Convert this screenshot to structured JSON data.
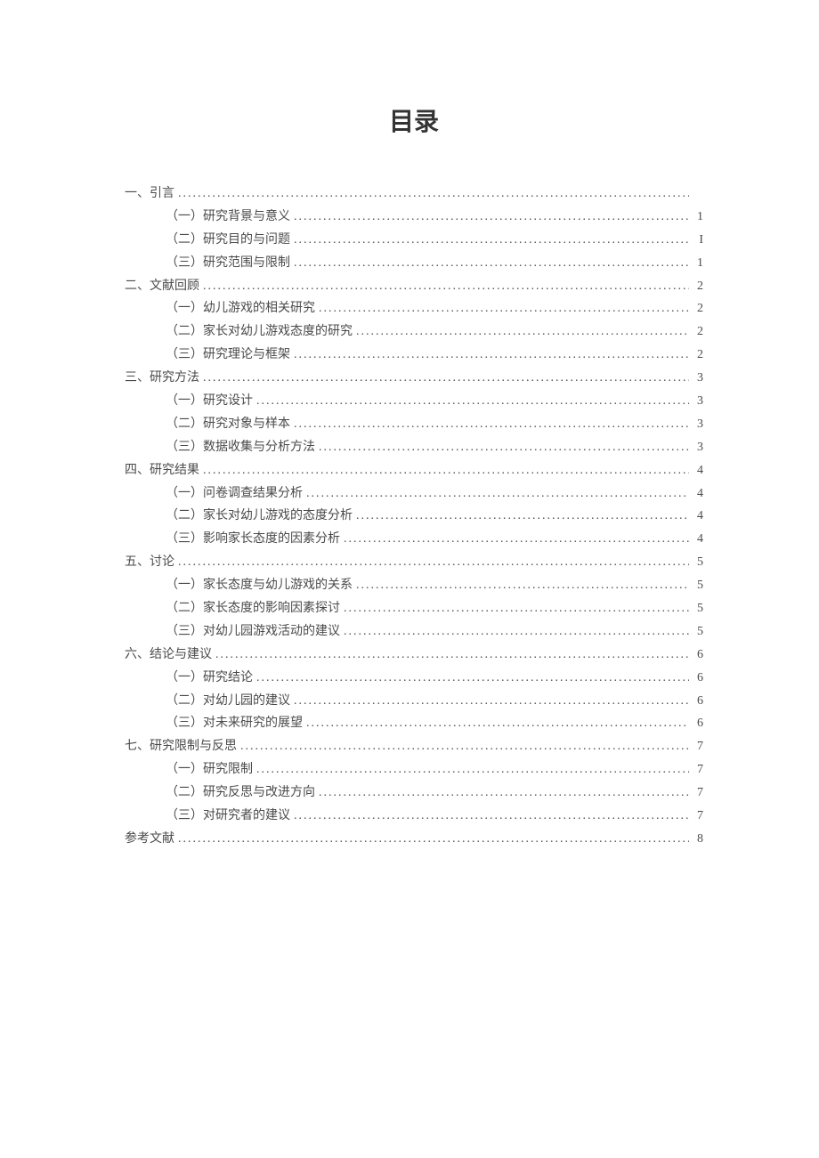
{
  "title": "目录",
  "entries": [
    {
      "level": 1,
      "label": "一、引言",
      "page": ""
    },
    {
      "level": 2,
      "label": "（一）研究背景与意义",
      "page": "1"
    },
    {
      "level": 2,
      "label": "（二）研究目的与问题",
      "page": "I"
    },
    {
      "level": 2,
      "label": "（三）研究范围与限制",
      "page": "1"
    },
    {
      "level": 1,
      "label": "二、文献回顾",
      "page": "2"
    },
    {
      "level": 2,
      "label": "（一）幼儿游戏的相关研究",
      "page": "2"
    },
    {
      "level": 2,
      "label": "（二）家长对幼儿游戏态度的研究",
      "page": "2"
    },
    {
      "level": 2,
      "label": "（三）研究理论与框架",
      "page": "2"
    },
    {
      "level": 1,
      "label": "三、研究方法",
      "page": "3"
    },
    {
      "level": 2,
      "label": "（一）研究设计",
      "page": "3"
    },
    {
      "level": 2,
      "label": "（二）研究对象与样本",
      "page": "3"
    },
    {
      "level": 2,
      "label": "（三）数据收集与分析方法",
      "page": "3"
    },
    {
      "level": 1,
      "label": "四、研究结果",
      "page": "4"
    },
    {
      "level": 2,
      "label": "（一）问卷调查结果分析",
      "page": "4"
    },
    {
      "level": 2,
      "label": "（二）家长对幼儿游戏的态度分析",
      "page": "4"
    },
    {
      "level": 2,
      "label": "（三）影响家长态度的因素分析",
      "page": "4"
    },
    {
      "level": 1,
      "label": "五、讨论",
      "page": "5"
    },
    {
      "level": 2,
      "label": "（一）家长态度与幼儿游戏的关系",
      "page": "5"
    },
    {
      "level": 2,
      "label": "（二）家长态度的影响因素探讨",
      "page": "5"
    },
    {
      "level": 2,
      "label": "（三）对幼儿园游戏活动的建议",
      "page": "5"
    },
    {
      "level": 1,
      "label": "六、结论与建议",
      "page": "6"
    },
    {
      "level": 2,
      "label": "（一）研究结论",
      "page": "6"
    },
    {
      "level": 2,
      "label": "（二）对幼儿园的建议",
      "page": "6"
    },
    {
      "level": 2,
      "label": "（三）对未来研究的展望",
      "page": "6"
    },
    {
      "level": 1,
      "label": "七、研究限制与反思",
      "page": "7"
    },
    {
      "level": 2,
      "label": "（一）研究限制",
      "page": "7"
    },
    {
      "level": 2,
      "label": "（二）研究反思与改进方向",
      "page": "7"
    },
    {
      "level": 2,
      "label": "（三）对研究者的建议",
      "page": "7"
    },
    {
      "level": 1,
      "label": "参考文献",
      "page": "8"
    }
  ]
}
